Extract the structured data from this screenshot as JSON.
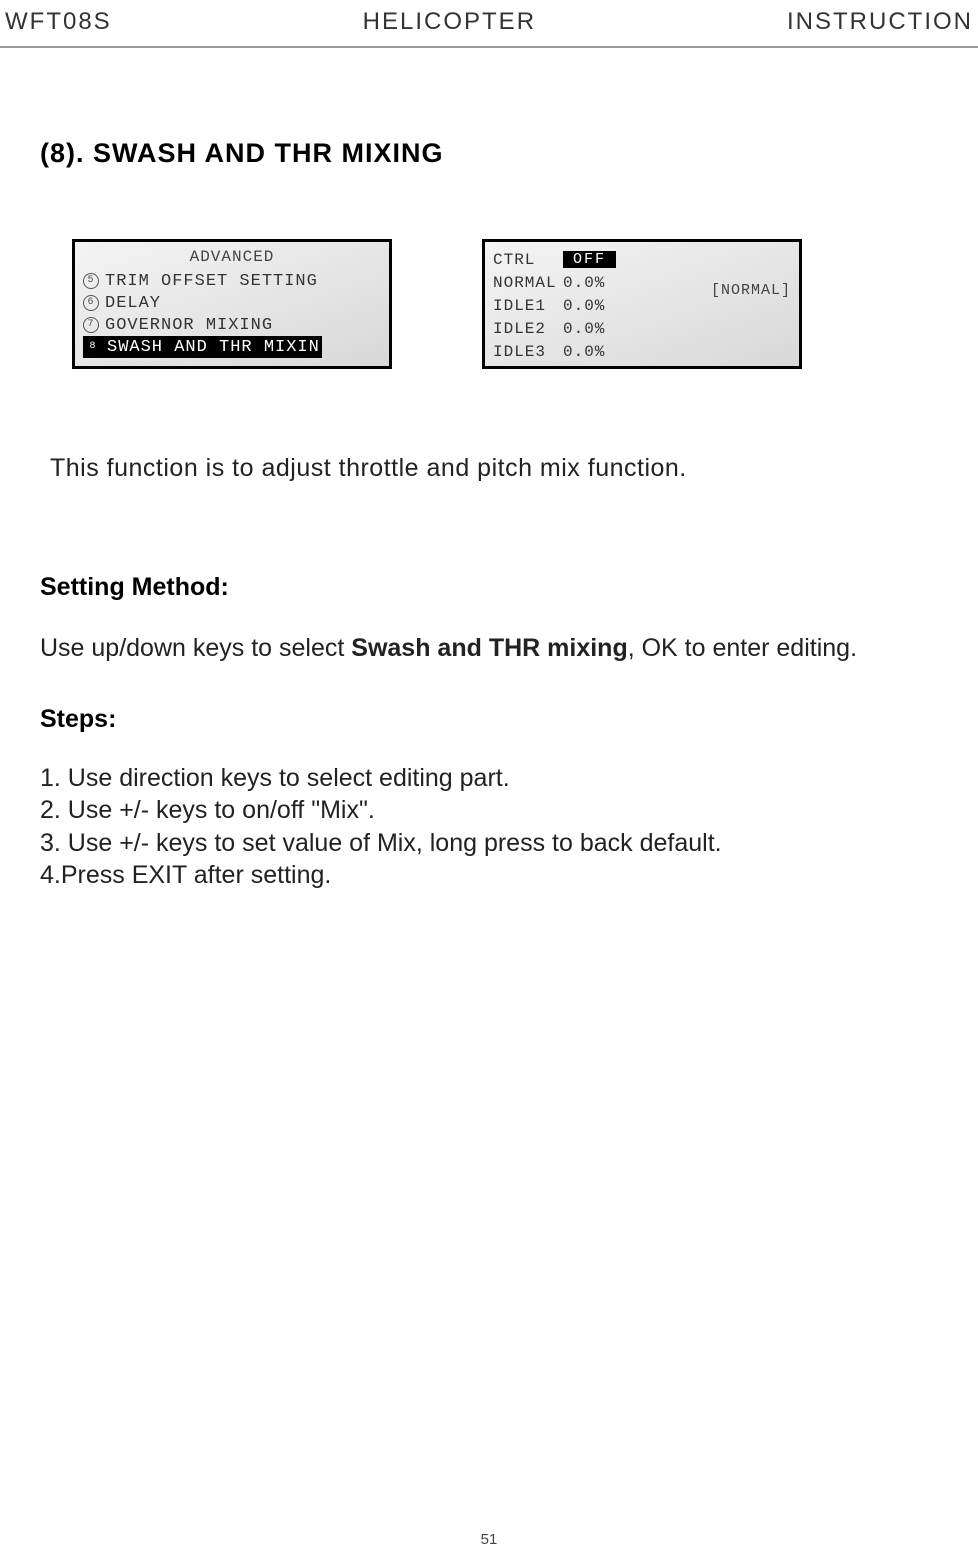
{
  "header": {
    "left": "WFT08S",
    "center": "HELICOPTER",
    "right": "INSTRUCTION"
  },
  "section_title": "(8). SWASH AND THR MIXING",
  "screen_left": {
    "title": "ADVANCED",
    "items": [
      {
        "num": "5",
        "label": "TRIM OFFSET SETTING"
      },
      {
        "num": "6",
        "label": "DELAY"
      },
      {
        "num": "7",
        "label": "GOVERNOR MIXING"
      },
      {
        "num": "8",
        "label": "SWASH AND THR MIXIN"
      }
    ]
  },
  "screen_right": {
    "ctrl_label": "CTRL",
    "ctrl_value": "OFF",
    "side_label": "[NORMAL]",
    "rows": [
      {
        "label": "NORMAL",
        "value": "0.0%"
      },
      {
        "label": "IDLE1",
        "value": "0.0%"
      },
      {
        "label": "IDLE2",
        "value": "0.0%"
      },
      {
        "label": "IDLE3",
        "value": "0.0%"
      }
    ]
  },
  "description": "This function is to adjust throttle and pitch mix function.",
  "setting_method_title": "Setting Method:",
  "setting_method_text_pre": "Use up/down keys to select ",
  "setting_method_text_bold": "Swash and THR mixing",
  "setting_method_text_post": ", OK to enter editing.",
  "steps_title": "Steps:",
  "steps": [
    "1. Use direction keys to select editing part.",
    "2. Use +/- keys to on/off \"Mix\".",
    "3. Use +/- keys to set value of Mix, long press to back default.",
    "4.Press EXIT after setting."
  ],
  "page_number": "51"
}
